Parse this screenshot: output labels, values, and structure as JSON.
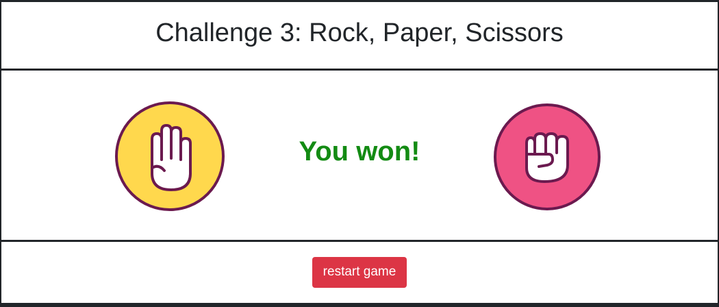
{
  "header": {
    "title": "Challenge 3: Rock, Paper, Scissors"
  },
  "game": {
    "player_choice": {
      "name": "paper",
      "icon": "paper-hand-icon",
      "color": "#ffd84d"
    },
    "bot_choice": {
      "name": "rock",
      "icon": "rock-fist-icon",
      "color": "#ef5284"
    },
    "result": {
      "text": "You won!",
      "color": "#138b13"
    }
  },
  "actions": {
    "restart_label": "restart game",
    "restart_color": "#dc3545"
  },
  "colors": {
    "border": "#212529",
    "icon_outline": "#6b1a4f"
  }
}
